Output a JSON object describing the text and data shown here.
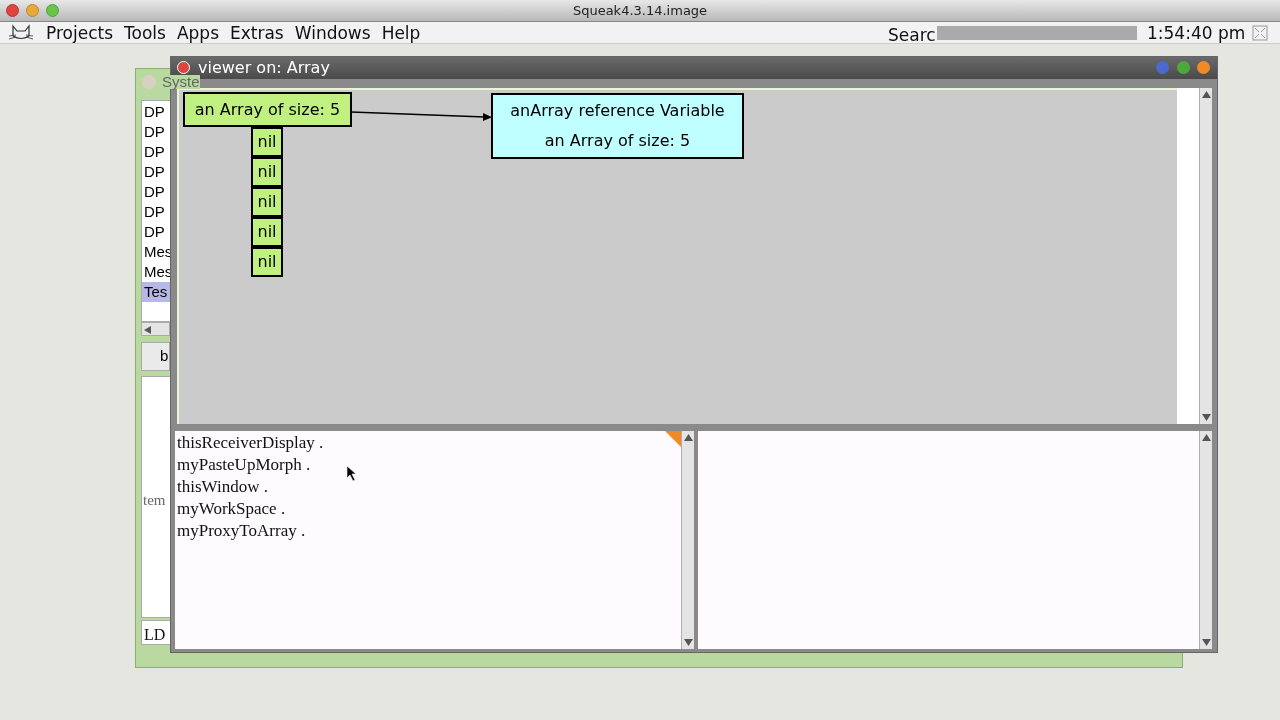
{
  "host_title": "Squeak4.3.14.image",
  "menu": {
    "items": [
      "Projects",
      "Tools",
      "Apps",
      "Extras",
      "Windows",
      "Help"
    ],
    "search_label": "Searc",
    "clock": "1:54:40 pm"
  },
  "background_window": {
    "title": "Syste",
    "list": [
      {
        "label": "DP",
        "selected": false
      },
      {
        "label": "DP",
        "selected": false
      },
      {
        "label": "DP",
        "selected": false
      },
      {
        "label": "DP",
        "selected": false
      },
      {
        "label": "DP",
        "selected": false
      },
      {
        "label": "DP",
        "selected": false
      },
      {
        "label": "DP",
        "selected": false
      },
      {
        "label": "Mes",
        "selected": false
      },
      {
        "label": "Mes",
        "selected": false
      },
      {
        "label": "Tes",
        "selected": true
      }
    ],
    "button": "b",
    "code_text": "tem",
    "status": "LD"
  },
  "viewer": {
    "title": "viewer on: Array",
    "array_node": {
      "label": "an Array of size: 5",
      "cells": [
        "nil",
        "nil",
        "nil",
        "nil",
        "nil"
      ]
    },
    "reference_node": {
      "lines": [
        "anArray reference Variable",
        "an Array of size: 5"
      ]
    },
    "workspace": [
      "thisReceiverDisplay .",
      "myPasteUpMorph .",
      "thisWindow .",
      "myWorkSpace .",
      "myProxyToArray ."
    ]
  }
}
